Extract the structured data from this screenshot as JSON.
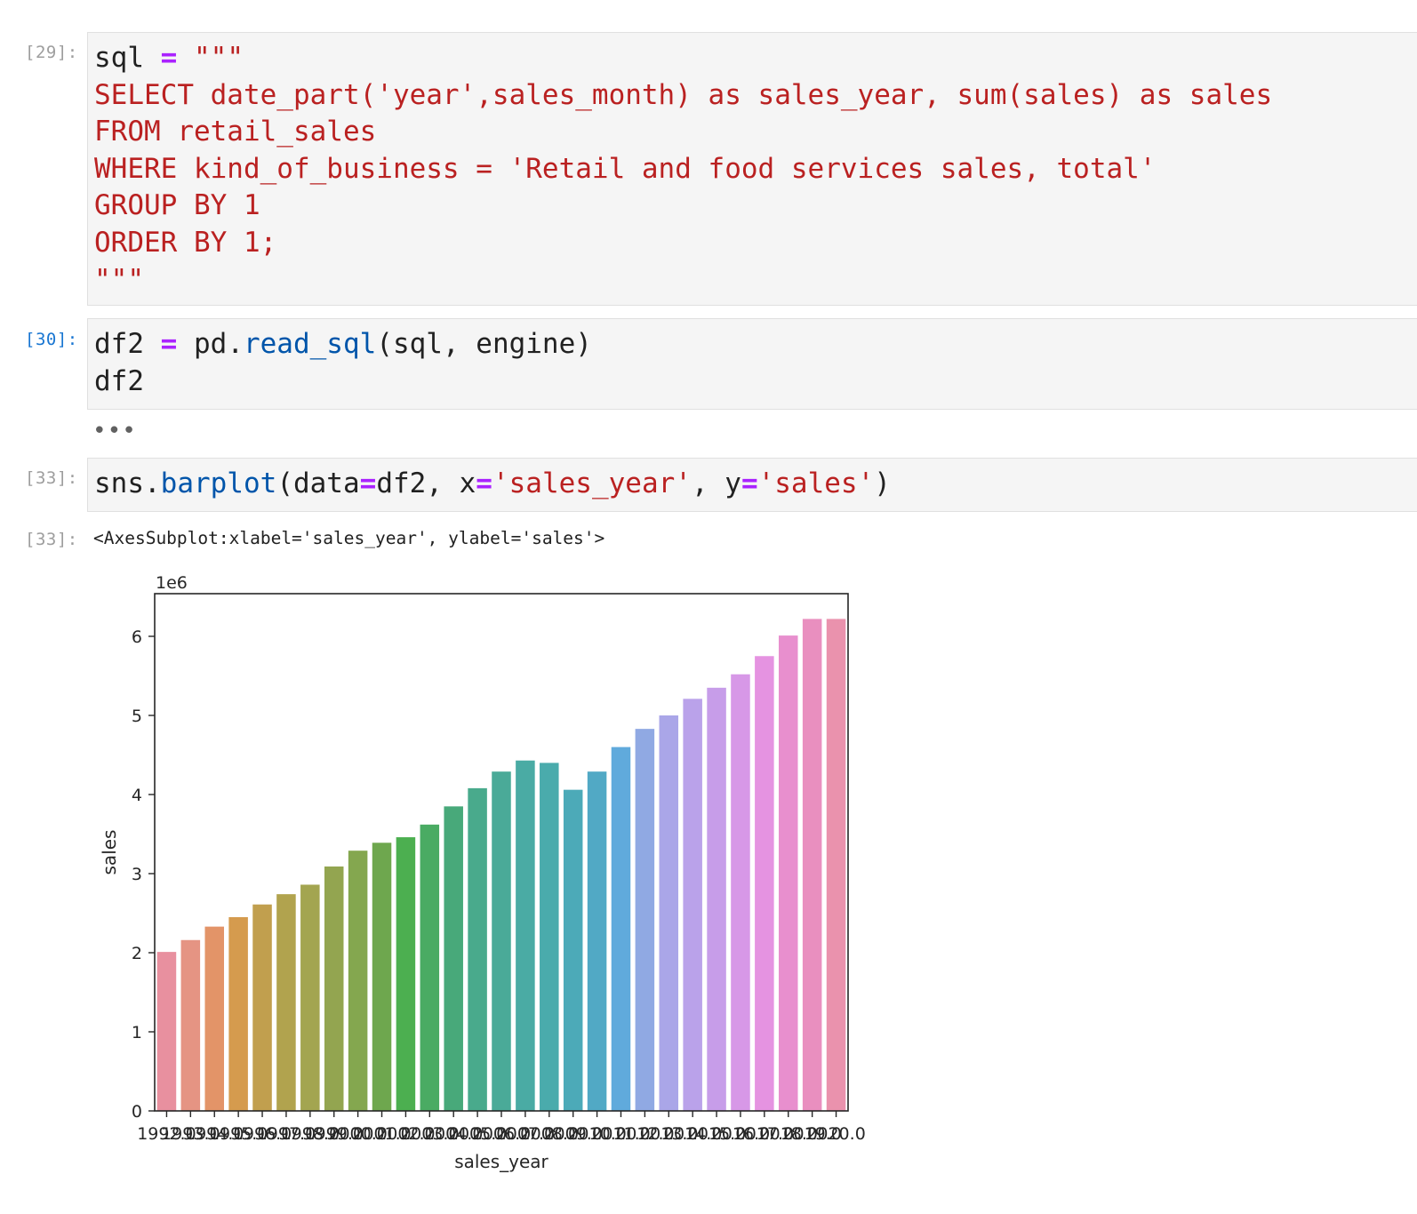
{
  "cells": [
    {
      "prompt": "[29]:",
      "lines": [
        [
          {
            "t": "sql ",
            "c": ""
          },
          {
            "t": "=",
            "c": "op"
          },
          {
            "t": " \"\"\"",
            "c": "str"
          }
        ],
        [
          {
            "t": "SELECT date_part('year',sales_month) as sales_year, sum(sales) as sales",
            "c": "str"
          }
        ],
        [
          {
            "t": "FROM retail_sales",
            "c": "str"
          }
        ],
        [
          {
            "t": "WHERE kind_of_business = 'Retail and food services sales, total'",
            "c": "str"
          }
        ],
        [
          {
            "t": "GROUP BY 1",
            "c": "str"
          }
        ],
        [
          {
            "t": "ORDER BY 1;",
            "c": "str"
          }
        ],
        [
          {
            "t": "\"\"\"",
            "c": "str"
          }
        ]
      ]
    },
    {
      "prompt": "[30]:",
      "lines": [
        [
          {
            "t": "df2 ",
            "c": ""
          },
          {
            "t": "=",
            "c": "op"
          },
          {
            "t": " pd.",
            "c": ""
          },
          {
            "t": "read_sql",
            "c": "fn"
          },
          {
            "t": "(sql, engine)",
            "c": ""
          }
        ],
        [
          {
            "t": "df2",
            "c": ""
          }
        ]
      ]
    },
    {
      "prompt": "[33]:",
      "lines": [
        [
          {
            "t": "sns.",
            "c": ""
          },
          {
            "t": "barplot",
            "c": "fn"
          },
          {
            "t": "(data",
            "c": ""
          },
          {
            "t": "=",
            "c": "op"
          },
          {
            "t": "df2, x",
            "c": ""
          },
          {
            "t": "=",
            "c": "op"
          },
          {
            "t": "'sales_year'",
            "c": "str"
          },
          {
            "t": ", y",
            "c": ""
          },
          {
            "t": "=",
            "c": "op"
          },
          {
            "t": "'sales'",
            "c": "str"
          },
          {
            "t": ")",
            "c": ""
          }
        ]
      ]
    }
  ],
  "collapsed_output": "•••",
  "output": {
    "prompt": "[33]:",
    "text": "<AxesSubplot:xlabel='sales_year', ylabel='sales'>"
  },
  "chart_data": {
    "type": "bar",
    "offset_label": "1e6",
    "xlabel": "sales_year",
    "ylabel": "sales",
    "ylim": [
      0,
      6.5
    ],
    "yticks": [
      "0",
      "1",
      "2",
      "3",
      "4",
      "5",
      "6"
    ],
    "categories": [
      "1992.0",
      "1993.0",
      "1994.0",
      "1995.0",
      "1996.0",
      "1997.0",
      "1998.0",
      "1999.0",
      "2000.0",
      "2001.0",
      "2002.0",
      "2003.0",
      "2004.0",
      "2005.0",
      "2006.0",
      "2007.0",
      "2008.0",
      "2009.0",
      "2010.0",
      "2011.0",
      "2012.0",
      "2013.0",
      "2014.0",
      "2015.0",
      "2016.0",
      "2017.0",
      "2018.0",
      "2019.0",
      "2020.0"
    ],
    "values": [
      2.01,
      2.16,
      2.33,
      2.45,
      2.61,
      2.74,
      2.86,
      3.09,
      3.29,
      3.39,
      3.46,
      3.62,
      3.85,
      4.08,
      4.29,
      4.43,
      4.4,
      4.06,
      4.29,
      4.6,
      4.83,
      5.0,
      5.21,
      5.35,
      5.52,
      5.75,
      6.01,
      6.22,
      6.22
    ],
    "colors": [
      "#e8909f",
      "#e59483",
      "#e39468",
      "#d59b4e",
      "#c19f4e",
      "#b1a34e",
      "#a3a550",
      "#93a550",
      "#84a74f",
      "#6ea74e",
      "#4caf50",
      "#4aab63",
      "#48a97a",
      "#49aa8c",
      "#4aaa98",
      "#4aaba4",
      "#4aabac",
      "#4caab8",
      "#51a9c5",
      "#60aadc",
      "#90a9e3",
      "#aaa6e8",
      "#baa2ea",
      "#c79de9",
      "#d798e7",
      "#e593e1",
      "#e88fce",
      "#e98fbf",
      "#ea92ad"
    ],
    "grid": false,
    "legend": "none"
  }
}
